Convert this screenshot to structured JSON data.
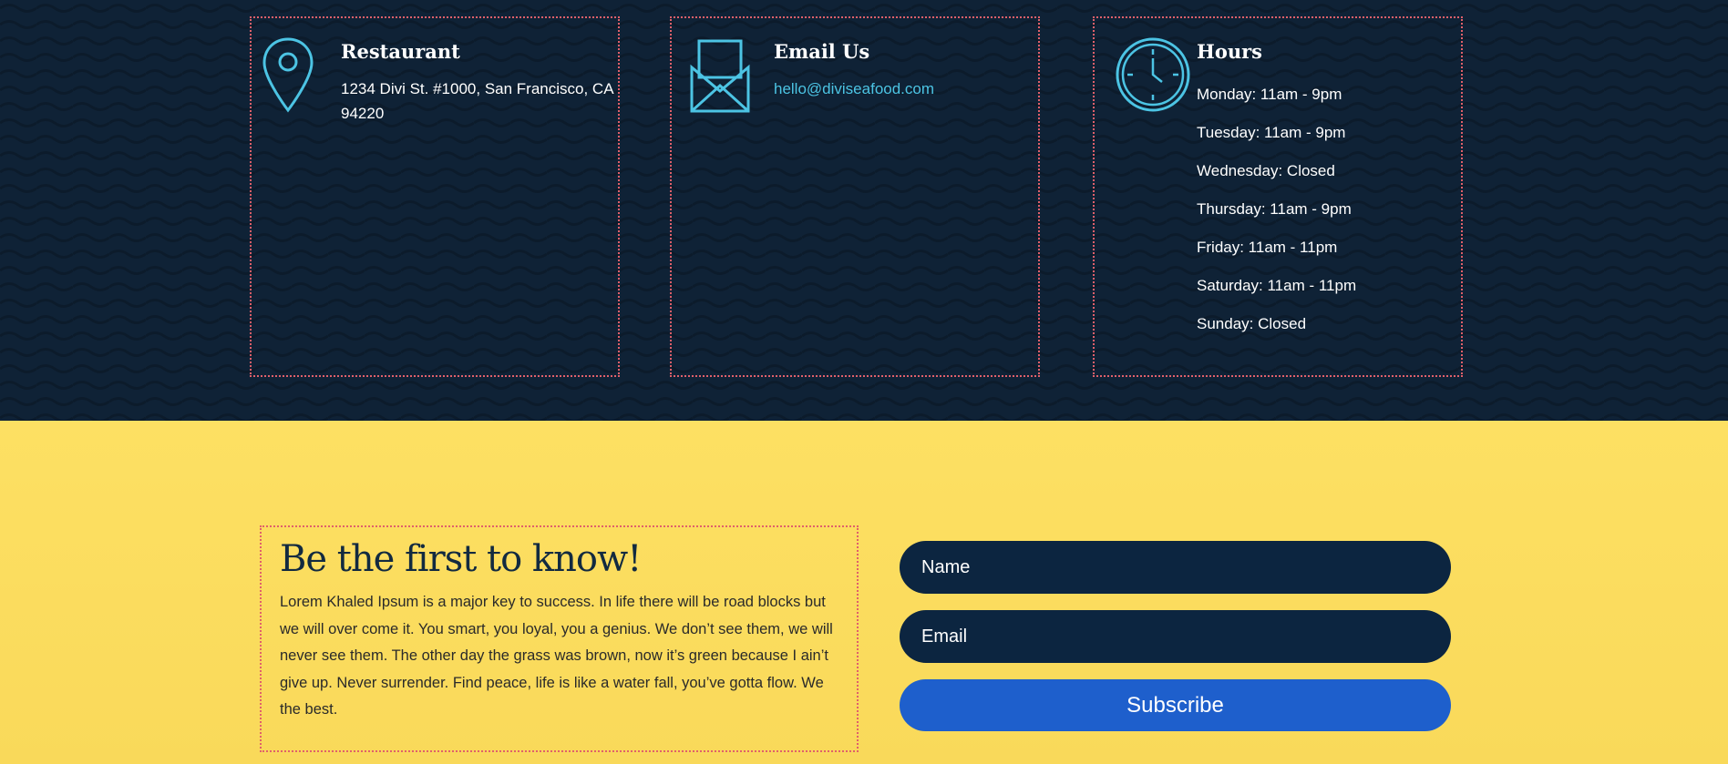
{
  "contact": {
    "restaurant": {
      "title": "Restaurant",
      "address": "1234 Divi St. #1000, San Francisco, CA 94220",
      "icon": "map-pin-icon"
    },
    "email": {
      "title": "Email Us",
      "address": "hello@diviseafood.com",
      "icon": "envelope-icon"
    },
    "hours": {
      "title": "Hours",
      "icon": "clock-icon",
      "lines": [
        "Monday: 11am - 9pm",
        "Tuesday: 11am - 9pm",
        "Wednesday: Closed",
        "Thursday: 11am - 9pm",
        "Friday: 11am - 11pm",
        "Saturday: 11am - 11pm",
        "Sunday: Closed"
      ]
    }
  },
  "newsletter": {
    "heading": "Be the first to know!",
    "body": "Lorem Khaled Ipsum is a major key to success. In life there will be road blocks but we will over come it. You smart, you loyal, you a genius. We don’t see them, we will never see them. The other day the grass was brown, now it’s green because I ain’t give up. Never surrender. Find peace, life is like a water fall, you’ve gotta flow. We the best.",
    "name_placeholder": "Name",
    "email_placeholder": "Email",
    "subscribe_label": "Subscribe"
  },
  "colors": {
    "dark_bg": "#0f2236",
    "accent": "#4cc4e4",
    "border": "#e0606a",
    "yellow": "#fcdb5c",
    "input": "#0c2540",
    "button": "#1e5fcc"
  }
}
